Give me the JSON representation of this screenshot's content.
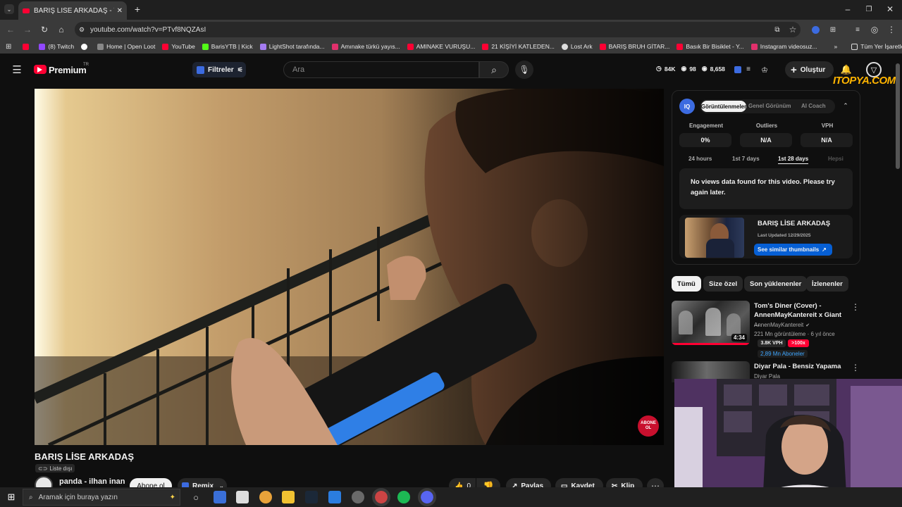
{
  "browser": {
    "tab_title": "BARIŞ LİSE ARKADAŞ - YouTube",
    "url": "youtube.com/watch?v=PTvf8NQZAsI",
    "bookmarks": [
      "(8) Twitch",
      "Home | Open Loot",
      "YouTube",
      "BarisYTB | Kick",
      "LightShot tarafında...",
      "Amınake türkü yayıs...",
      "AMINAKE VURUŞU...",
      "21 KİŞİYİ KATLEDEN...",
      "Lost Ark",
      "BARIŞ BRUH GİTAR...",
      "Basık Bir Bisiklet - Y...",
      "Instagram videosuz..."
    ],
    "all_bookmarks": "Tüm Yer İşaretleri"
  },
  "header": {
    "logo": "Premium",
    "logo_sup": "TR",
    "filters": "Filtreler",
    "search_placeholder": "Ara",
    "stats": [
      "84K",
      "98",
      "8,658"
    ],
    "create": "Oluştur",
    "watermark": "ITOPYA.COM"
  },
  "video": {
    "title": "BARIŞ LİSE ARKADAŞ",
    "unlisted": "Liste dışı",
    "channel": "panda - ilhan inan",
    "subscribe": "Abone ol",
    "remix": "Remix",
    "likes": "0",
    "share": "Paylaş",
    "save": "Kaydet",
    "clip": "Klip",
    "abone_badge": "ABONE OL"
  },
  "panel": {
    "tabs": [
      "Görüntülenmeler",
      "Genel Görünüm",
      "AI Coach"
    ],
    "metrics": [
      {
        "label": "Engagement",
        "value": "0%"
      },
      {
        "label": "Outliers",
        "value": "N/A"
      },
      {
        "label": "VPH",
        "value": "N/A"
      }
    ],
    "ranges": [
      "24 hours",
      "1st 7 days",
      "1st 28 days",
      "Hepsi"
    ],
    "message": "No views data found for this video. Please try again later.",
    "thumb_title": "BARIŞ LİSE ARKADAŞ",
    "updated": "Last Updated 12/29/2025",
    "similar_btn": "See similar thumbnails"
  },
  "filters": [
    "Tümü",
    "Size özel",
    "Son yüklenenler",
    "İzlenenler"
  ],
  "recommendations": [
    {
      "title": "Tom's Diner (Cover) - AnnenMayKantereit x Giant ...",
      "channel": "AnnenMayKantereit",
      "meta": "221 Mn görüntüleme · 6 yıl önce",
      "vph": "3.8K VPH",
      "outlier": ">100x",
      "subs": "2,89 Mn Aboneler",
      "duration": "4:34"
    },
    {
      "title": "Diyar Pala - Bensiz Yapama",
      "channel": "Diyar Pala",
      "meta": "",
      "vph": "",
      "outlier": "",
      "subs": "",
      "duration": ""
    }
  ],
  "taskbar": {
    "search": "Aramak için buraya yazın"
  },
  "colors": {
    "accent": "#3ea6ff",
    "youtube_red": "#ff0033",
    "similar_btn": "#065fd4"
  }
}
